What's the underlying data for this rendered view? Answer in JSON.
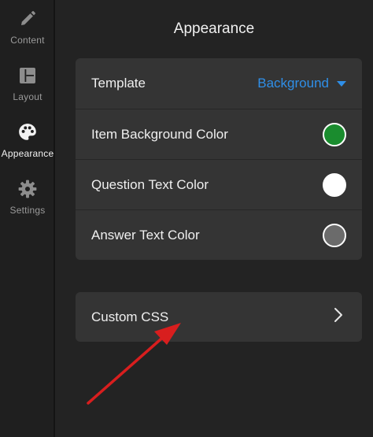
{
  "sidebar": {
    "items": [
      {
        "id": "content",
        "label": "Content",
        "icon": "pencil-icon"
      },
      {
        "id": "layout",
        "label": "Layout",
        "icon": "layout-icon"
      },
      {
        "id": "appearance",
        "label": "Appearance",
        "icon": "palette-icon",
        "active": true
      },
      {
        "id": "settings",
        "label": "Settings",
        "icon": "gear-icon"
      }
    ]
  },
  "panel": {
    "title": "Appearance",
    "rows": {
      "template": {
        "label": "Template",
        "value": "Background"
      },
      "item_bg": {
        "label": "Item Background Color",
        "color": "#1a8c2e"
      },
      "question": {
        "label": "Question Text Color",
        "color": "#ffffff"
      },
      "answer": {
        "label": "Answer Text Color",
        "color": "#6b6b6b"
      }
    },
    "custom_css": {
      "label": "Custom CSS",
      "icon": "chevron-right-icon"
    }
  },
  "colors": {
    "accent": "#2f8fe8",
    "annotation_arrow": "#d81e1e"
  }
}
